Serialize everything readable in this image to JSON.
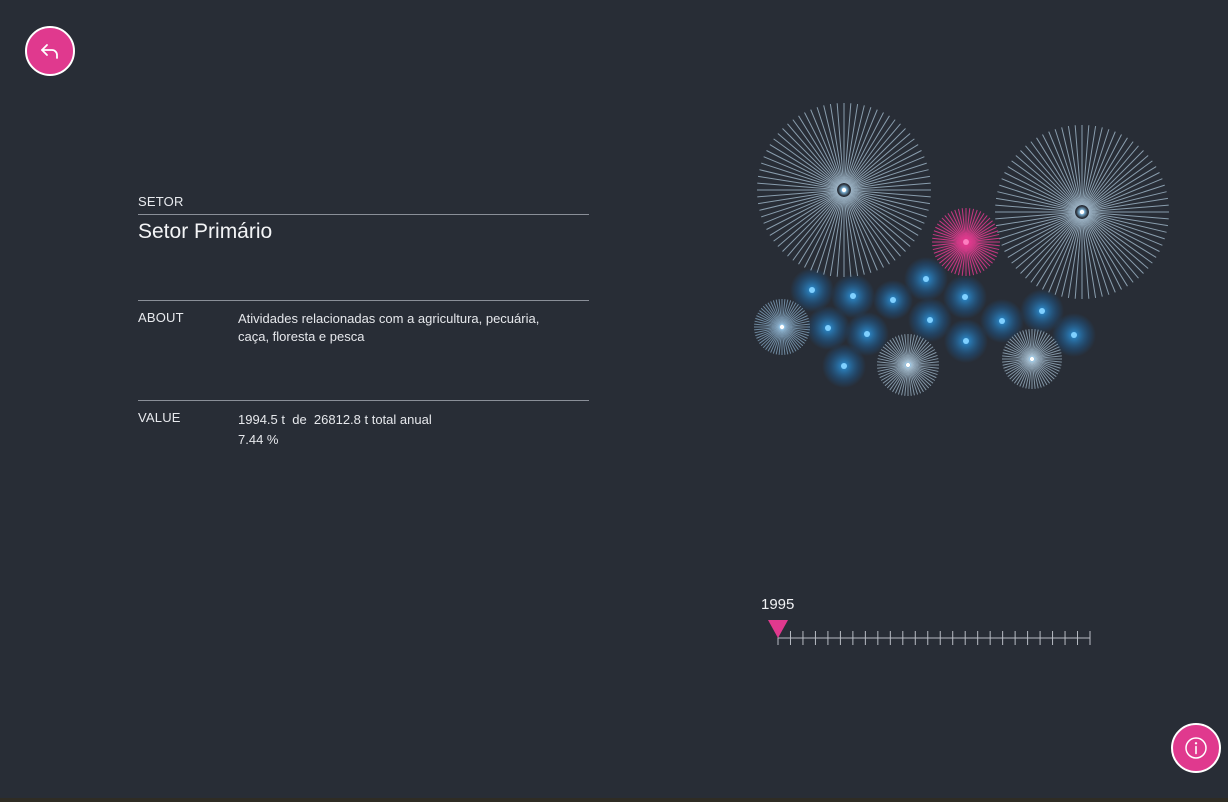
{
  "nav": {
    "back_icon": "return-arrow-icon",
    "info_icon": "info-icon"
  },
  "colors": {
    "background": "#282d36",
    "accent": "#e0398e",
    "burst": "#a9c3d6",
    "bubble": "#2b6fa6",
    "highlight": "#e0398e"
  },
  "sector": {
    "label": "SETOR",
    "name": "Setor Primário"
  },
  "about": {
    "label": "ABOUT",
    "text": "Atividades relacionadas com a agricultura, pecuária, caça, floresta e pesca"
  },
  "value": {
    "label": "VALUE",
    "line1": "1994.5 t  de  26812.8 t total anual",
    "percent": "7.44 %"
  },
  "timeline": {
    "year": "1995",
    "tick_count": 26
  }
}
